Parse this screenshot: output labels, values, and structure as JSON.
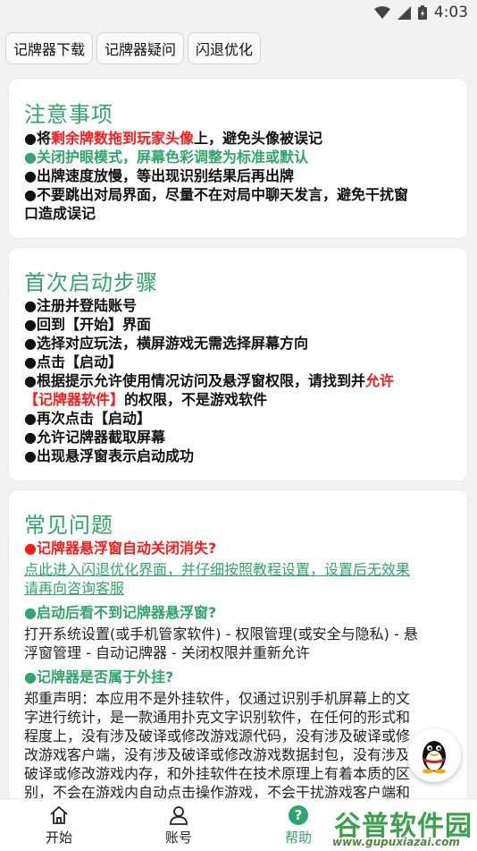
{
  "status_bar": {
    "time": "4:03"
  },
  "tabs": [
    "记牌器下载",
    "记牌器疑问",
    "闪退优化"
  ],
  "notes": {
    "title": "注意事项",
    "line1": {
      "a": "●将",
      "b": "剩余牌数拖到玩家头像",
      "c": "上，避免头像被误记"
    },
    "line2": "●关闭护眼模式，屏幕色彩调整为标准或默认",
    "line3": "●出牌速度放慢，等出现识别结果后再出牌",
    "line4a": "●不要跳出对局界面，尽量不在对局中聊天发言，避免干扰窗",
    "line4b": "口造成误记"
  },
  "startup": {
    "title": "首次启动步骤",
    "step1": "●注册并登陆账号",
    "step2": "●回到【开始】界面",
    "step3": "●选择对应玩法，横屏游戏无需选择屏幕方向",
    "step4": "●点击【启动】",
    "step5a": "●根据提示允许使用情况访问及悬浮窗权限，请找到并",
    "step5b": "允许",
    "step5c": "【记牌器软件】",
    "step5d": "的权限，不是游戏软件",
    "step6": "●再次点击【启动】",
    "step7": "●允许记牌器截取屏幕",
    "step8": "●出现悬浮窗表示启动成功"
  },
  "faq": {
    "title": "常见问题",
    "q1": "●记牌器悬浮窗自动关闭消失?",
    "a1a": "点此进入闪退优化界面，并仔细按照教程设置，设置后无效果",
    "a1b": "请再向咨询客服",
    "q2": "●启动后看不到记牌器悬浮窗?",
    "a2a": "打开系统设置(或手机管家软件) - 权限管理(或安全与隐私) - 悬",
    "a2b": "浮窗管理 - 自动记牌器 - 关闭权限并重新允许",
    "q3": "●记牌器是否属于外挂?",
    "a3a": "郑重声明：本应用不是外挂软件，仅通过识别手机屏幕上的文",
    "a3b": "字进行统计，是一款通用扑克文字识别软件，在任何的形式和",
    "a3c": "程度上，没有涉及破译或修改游戏源代码，没有涉及破译或修",
    "a3d": "改游戏客户端，没有涉及破译或修改游戏数据封包，没有涉及",
    "a3e": "破译或修改游戏内存，和外挂软件在技术原理上有着本质的区",
    "a3f": "别，不会在游戏内自动点击操作游戏，不会干扰游戏客户端和"
  },
  "nav": {
    "start": "开始",
    "account": "账号",
    "help": "帮助"
  },
  "watermark": {
    "main": "谷普软件园",
    "url": "www.gupuxiazai.com"
  },
  "colors": {
    "accent_green": "#2fa66a",
    "alert_red": "#ff1a1a"
  }
}
